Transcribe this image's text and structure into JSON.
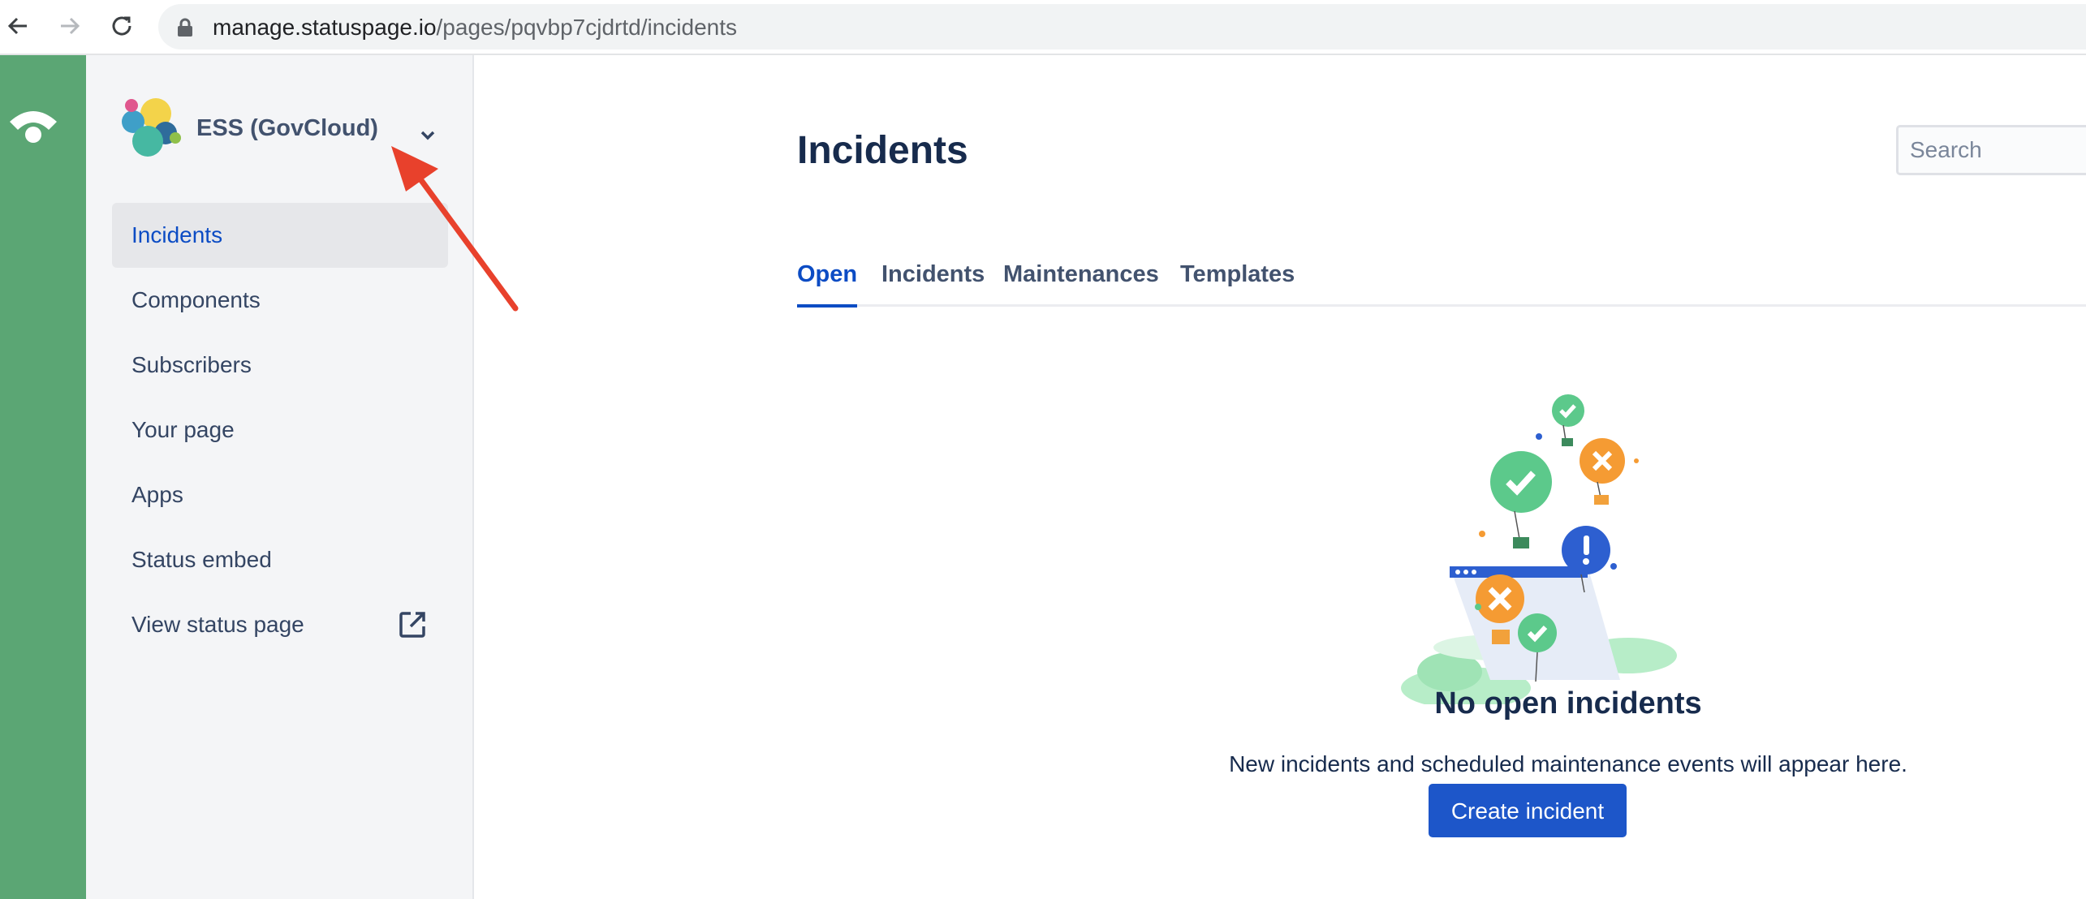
{
  "browser": {
    "url_domain": "manage.statuspage.io",
    "url_path": "/pages/pqvbp7cjdrtd/incidents"
  },
  "sidebar": {
    "page_name": "ESS (GovCloud)",
    "items": [
      {
        "label": "Incidents",
        "active": true
      },
      {
        "label": "Components"
      },
      {
        "label": "Subscribers"
      },
      {
        "label": "Your page"
      },
      {
        "label": "Apps"
      },
      {
        "label": "Status embed"
      },
      {
        "label": "View status page",
        "icon": "external-link-icon"
      }
    ]
  },
  "main": {
    "title": "Incidents",
    "search_placeholder": "Search",
    "tabs": [
      {
        "label": "Open",
        "active": true
      },
      {
        "label": "Incidents"
      },
      {
        "label": "Maintenances"
      },
      {
        "label": "Templates"
      }
    ],
    "empty_state": {
      "title": "No open incidents",
      "description": "New incidents and scheduled maintenance events will appear here.",
      "button_label": "Create incident"
    }
  },
  "colors": {
    "rail": "#5ba674",
    "accent": "#0c4cc4",
    "button": "#1d56c9",
    "annotation_arrow": "#e8412c"
  }
}
